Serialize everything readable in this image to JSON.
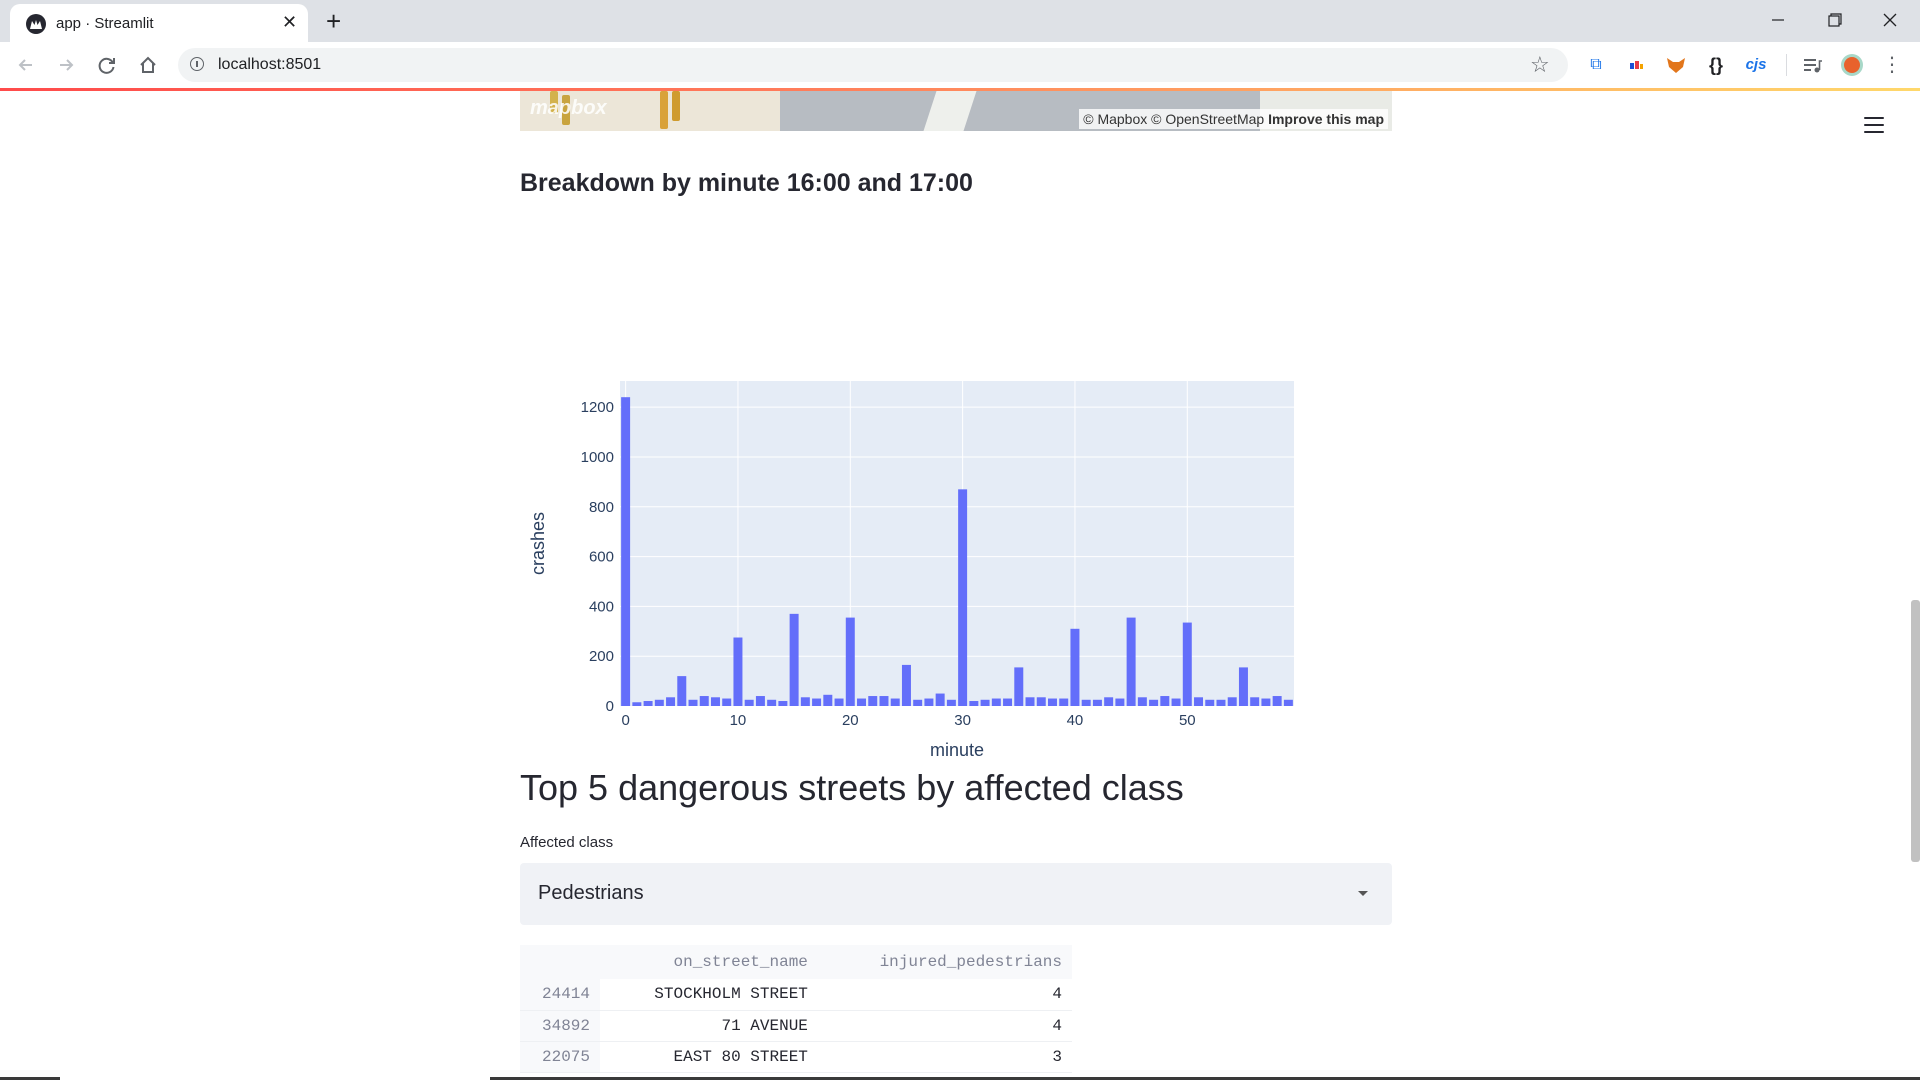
{
  "browser": {
    "tab_title": "app · Streamlit",
    "url": "localhost:8501",
    "extensions": [
      "translate-icon",
      "color-icon",
      "fox-icon",
      "braces-icon",
      "cjs-icon",
      "playlist-icon",
      "avatar-icon"
    ],
    "cjs_label": "cjs",
    "braces_label": "{}"
  },
  "map": {
    "logo": "mapbox",
    "attribution": "© Mapbox © OpenStreetMap",
    "improve_link": "Improve this map"
  },
  "breakdown": {
    "title": "Breakdown by minute 16:00 and 17:00"
  },
  "chart_data": {
    "type": "bar",
    "x": [
      0,
      1,
      2,
      3,
      4,
      5,
      6,
      7,
      8,
      9,
      10,
      11,
      12,
      13,
      14,
      15,
      16,
      17,
      18,
      19,
      20,
      21,
      22,
      23,
      24,
      25,
      26,
      27,
      28,
      29,
      30,
      31,
      32,
      33,
      34,
      35,
      36,
      37,
      38,
      39,
      40,
      41,
      42,
      43,
      44,
      45,
      46,
      47,
      48,
      49,
      50,
      51,
      52,
      53,
      54,
      55,
      56,
      57,
      58,
      59
    ],
    "values": [
      1240,
      15,
      20,
      25,
      35,
      120,
      25,
      40,
      35,
      30,
      275,
      25,
      40,
      25,
      20,
      370,
      35,
      30,
      45,
      30,
      355,
      30,
      40,
      40,
      30,
      165,
      25,
      30,
      50,
      25,
      870,
      20,
      25,
      30,
      30,
      155,
      35,
      35,
      30,
      30,
      310,
      25,
      25,
      35,
      30,
      355,
      35,
      25,
      40,
      30,
      335,
      35,
      25,
      25,
      35,
      155,
      35,
      30,
      40,
      25
    ],
    "xlabel": "minute",
    "ylabel": "crashes",
    "xlim": [
      -0.5,
      59.5
    ],
    "ylim": [
      0,
      1305
    ],
    "xticks": [
      0,
      10,
      20,
      30,
      40,
      50
    ],
    "yticks": [
      0,
      200,
      400,
      600,
      800,
      1000,
      1200
    ],
    "bar_color": "#636efa",
    "plot_bg": "#e5ecf6",
    "grid": true
  },
  "section": {
    "title": "Top 5 dangerous streets by affected class"
  },
  "select": {
    "label": "Affected class",
    "value": "Pedestrians"
  },
  "table": {
    "columns": [
      "",
      "on_street_name",
      "injured_pedestrians"
    ],
    "rows": [
      {
        "index": "24414",
        "street": "STOCKHOLM STREET",
        "count": "4"
      },
      {
        "index": "34892",
        "street": "71 AVENUE",
        "count": "4"
      },
      {
        "index": "22075",
        "street": "EAST 80 STREET",
        "count": "3"
      }
    ]
  }
}
